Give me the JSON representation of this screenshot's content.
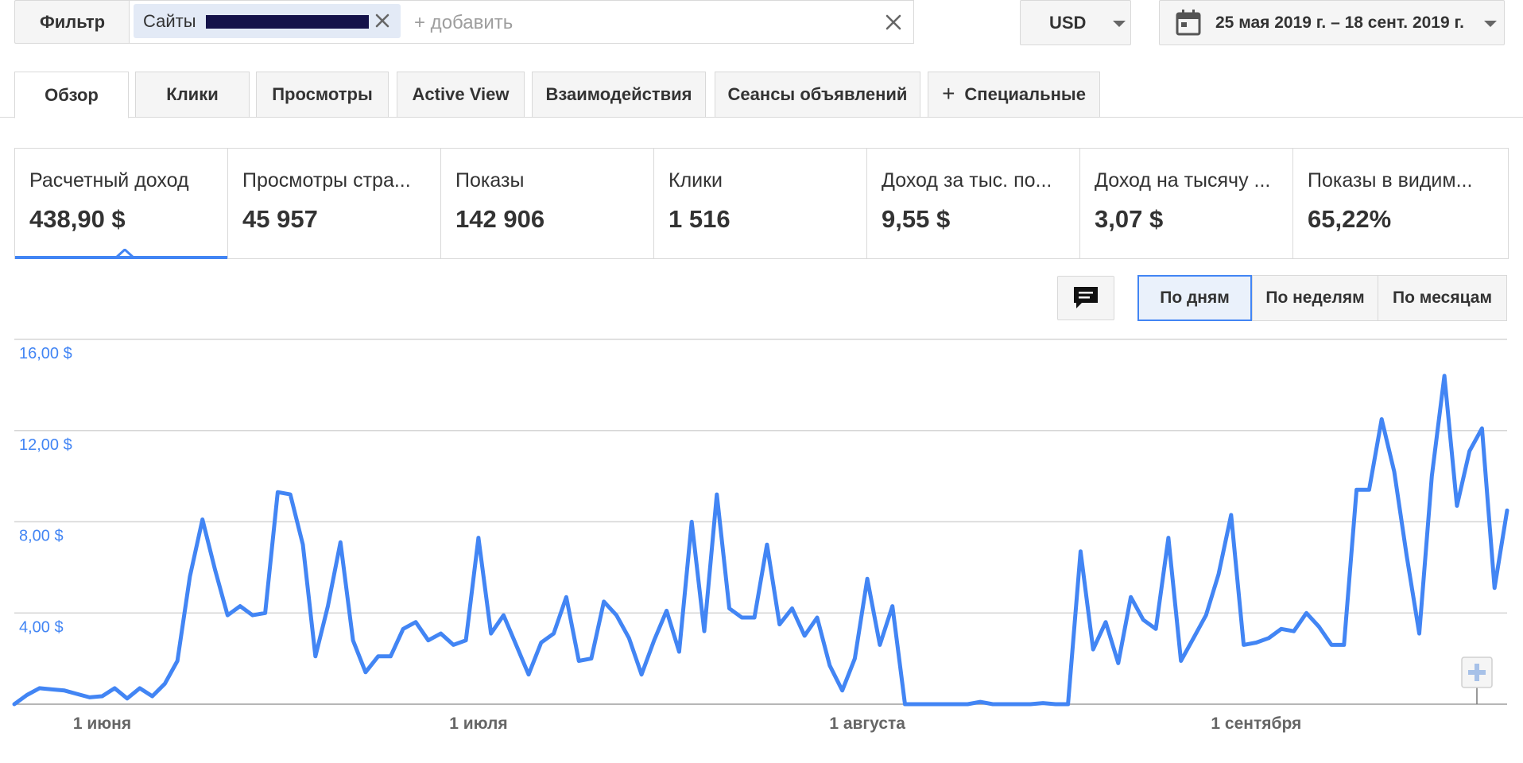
{
  "filter": {
    "label": "Фильтр",
    "chip_text": "Сайты",
    "add_label": "+ добавить"
  },
  "currency": {
    "value": "USD"
  },
  "daterange": {
    "value": "25 мая 2019 г. – 18 сент. 2019 г."
  },
  "tabs": [
    {
      "label": "Обзор",
      "active": true
    },
    {
      "label": "Клики"
    },
    {
      "label": "Просмотры"
    },
    {
      "label": "Active View"
    },
    {
      "label": "Взаимодействия"
    },
    {
      "label": "Сеансы объявлений"
    },
    {
      "label": "Специальные",
      "icon": "plus-icon"
    }
  ],
  "metrics": [
    {
      "label": "Расчетный доход",
      "value": "438,90 $",
      "active": true
    },
    {
      "label": "Просмотры стра...",
      "value": "45 957"
    },
    {
      "label": "Показы",
      "value": "142 906"
    },
    {
      "label": "Клики",
      "value": "1 516"
    },
    {
      "label": "Доход за тыс. по...",
      "value": "9,55 $"
    },
    {
      "label": "Доход на тысячу ...",
      "value": "3,07 $"
    },
    {
      "label": "Показы в видим...",
      "value": "65,22%"
    }
  ],
  "granularity": {
    "daily": "По дням",
    "weekly": "По неделям",
    "monthly": "По месяцам",
    "selected": "daily"
  },
  "colors": {
    "line": "#4285f4",
    "axis_label": "#4285f4",
    "active_tab_border": "#4285f4"
  },
  "chart_data": {
    "type": "line",
    "title": "",
    "xlabel": "",
    "ylabel": "",
    "ylim": [
      0,
      16
    ],
    "y_ticks": [
      "16,00 $",
      "12,00 $",
      "8,00 $",
      "4,00 $"
    ],
    "y_tick_values": [
      16,
      12,
      8,
      4
    ],
    "x_ticks": [
      {
        "label": "1 июня",
        "index": 7
      },
      {
        "label": "1 июля",
        "index": 37
      },
      {
        "label": "1 августа",
        "index": 68
      },
      {
        "label": "1 сентября",
        "index": 99
      }
    ],
    "grid": true,
    "x_start": "2019-05-25",
    "series": [
      {
        "values": [
          0.0,
          0.4,
          0.7,
          0.65,
          0.6,
          0.45,
          0.3,
          0.35,
          0.7,
          0.25,
          0.7,
          0.35,
          0.9,
          1.9,
          5.6,
          8.1,
          5.9,
          3.9,
          4.3,
          3.9,
          4.0,
          9.3,
          9.2,
          7.0,
          2.1,
          4.3,
          7.1,
          2.8,
          1.4,
          2.1,
          2.1,
          3.3,
          3.6,
          2.8,
          3.1,
          2.6,
          2.8,
          7.3,
          3.1,
          3.9,
          2.6,
          1.3,
          2.7,
          3.1,
          4.7,
          1.9,
          2.0,
          4.5,
          3.9,
          2.9,
          1.3,
          2.8,
          4.1,
          2.3,
          8.0,
          3.2,
          9.2,
          4.2,
          3.8,
          3.8,
          7.0,
          3.5,
          4.2,
          3.0,
          3.8,
          1.7,
          0.6,
          2.0,
          5.5,
          2.6,
          4.3,
          0.0,
          0.0,
          0.0,
          0.0,
          0.0,
          0.0,
          0.1,
          0.0,
          0.0,
          0.0,
          0.0,
          0.05,
          0.0,
          0.0,
          6.7,
          2.4,
          3.6,
          1.8,
          4.7,
          3.7,
          3.3,
          7.3,
          1.9,
          2.9,
          3.9,
          5.7,
          8.3,
          2.6,
          2.7,
          2.9,
          3.3,
          3.2,
          4.0,
          3.4,
          2.6,
          2.6,
          9.4,
          9.4,
          12.5,
          10.2,
          6.5,
          3.1,
          10.0,
          14.4,
          8.7,
          11.1,
          12.1,
          5.1,
          8.5
        ]
      }
    ]
  }
}
